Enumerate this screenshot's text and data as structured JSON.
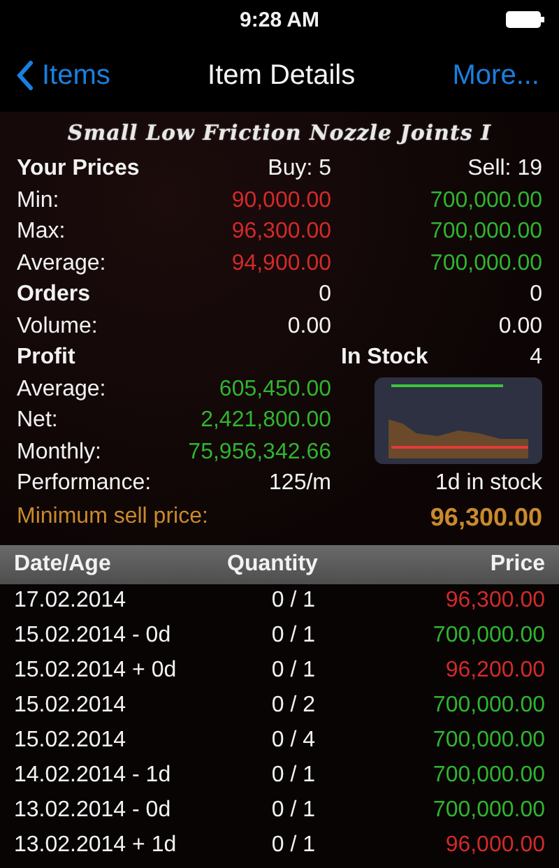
{
  "status_bar": {
    "time": "9:28 AM"
  },
  "nav": {
    "back": "Items",
    "title": "Item Details",
    "action": "More..."
  },
  "item_name": "Small Low Friction Nozzle Joints I",
  "prices": {
    "heading": "Your Prices",
    "buy_header": "Buy: 5",
    "sell_header": "Sell: 19",
    "rows": [
      {
        "kind": "price",
        "label": "Min:",
        "buy": "90,000.00",
        "sell": "700,000.00"
      },
      {
        "kind": "price",
        "label": "Max:",
        "buy": "96,300.00",
        "sell": "700,000.00"
      },
      {
        "kind": "price",
        "label": "Average:",
        "buy": "94,900.00",
        "sell": "700,000.00"
      },
      {
        "kind": "heading",
        "label": "Orders",
        "buy": "0",
        "sell": "0"
      },
      {
        "kind": "plain",
        "label": "Volume:",
        "buy": "0.00",
        "sell": "0.00"
      }
    ]
  },
  "profit": {
    "heading": "Profit",
    "rows": [
      {
        "label": "Average:",
        "value": "605,450.00"
      },
      {
        "label": "Net:",
        "value": "2,421,800.00"
      },
      {
        "label": "Monthly:",
        "value": "75,956,342.66"
      }
    ]
  },
  "in_stock": {
    "label": "In Stock",
    "count": "4"
  },
  "performance": {
    "label": "Performance:",
    "value": "125/m",
    "stock_age": "1d in stock"
  },
  "minimum_sell": {
    "label": "Minimum sell price:",
    "value": "96,300.00"
  },
  "table": {
    "columns": [
      "Date/Age",
      "Quantity",
      "Price"
    ],
    "rows": [
      {
        "date": "17.02.2014",
        "quantity": "0 / 1",
        "price": "96,300.00",
        "color": "#d42a2a"
      },
      {
        "date": "15.02.2014 - 0d",
        "quantity": "0 / 1",
        "price": "700,000.00",
        "color": "#2fb52f"
      },
      {
        "date": "15.02.2014 + 0d",
        "quantity": "0 / 1",
        "price": "96,200.00",
        "color": "#d42a2a"
      },
      {
        "date": "15.02.2014",
        "quantity": "0 / 2",
        "price": "700,000.00",
        "color": "#2fb52f"
      },
      {
        "date": "15.02.2014",
        "quantity": "0 / 4",
        "price": "700,000.00",
        "color": "#2fb52f"
      },
      {
        "date": "14.02.2014 - 1d",
        "quantity": "0 / 1",
        "price": "700,000.00",
        "color": "#2fb52f"
      },
      {
        "date": "13.02.2014 - 0d",
        "quantity": "0 / 1",
        "price": "700,000.00",
        "color": "#2fb52f"
      },
      {
        "date": "13.02.2014 + 1d",
        "quantity": "0 / 1",
        "price": "96,000.00",
        "color": "#d42a2a"
      }
    ]
  }
}
